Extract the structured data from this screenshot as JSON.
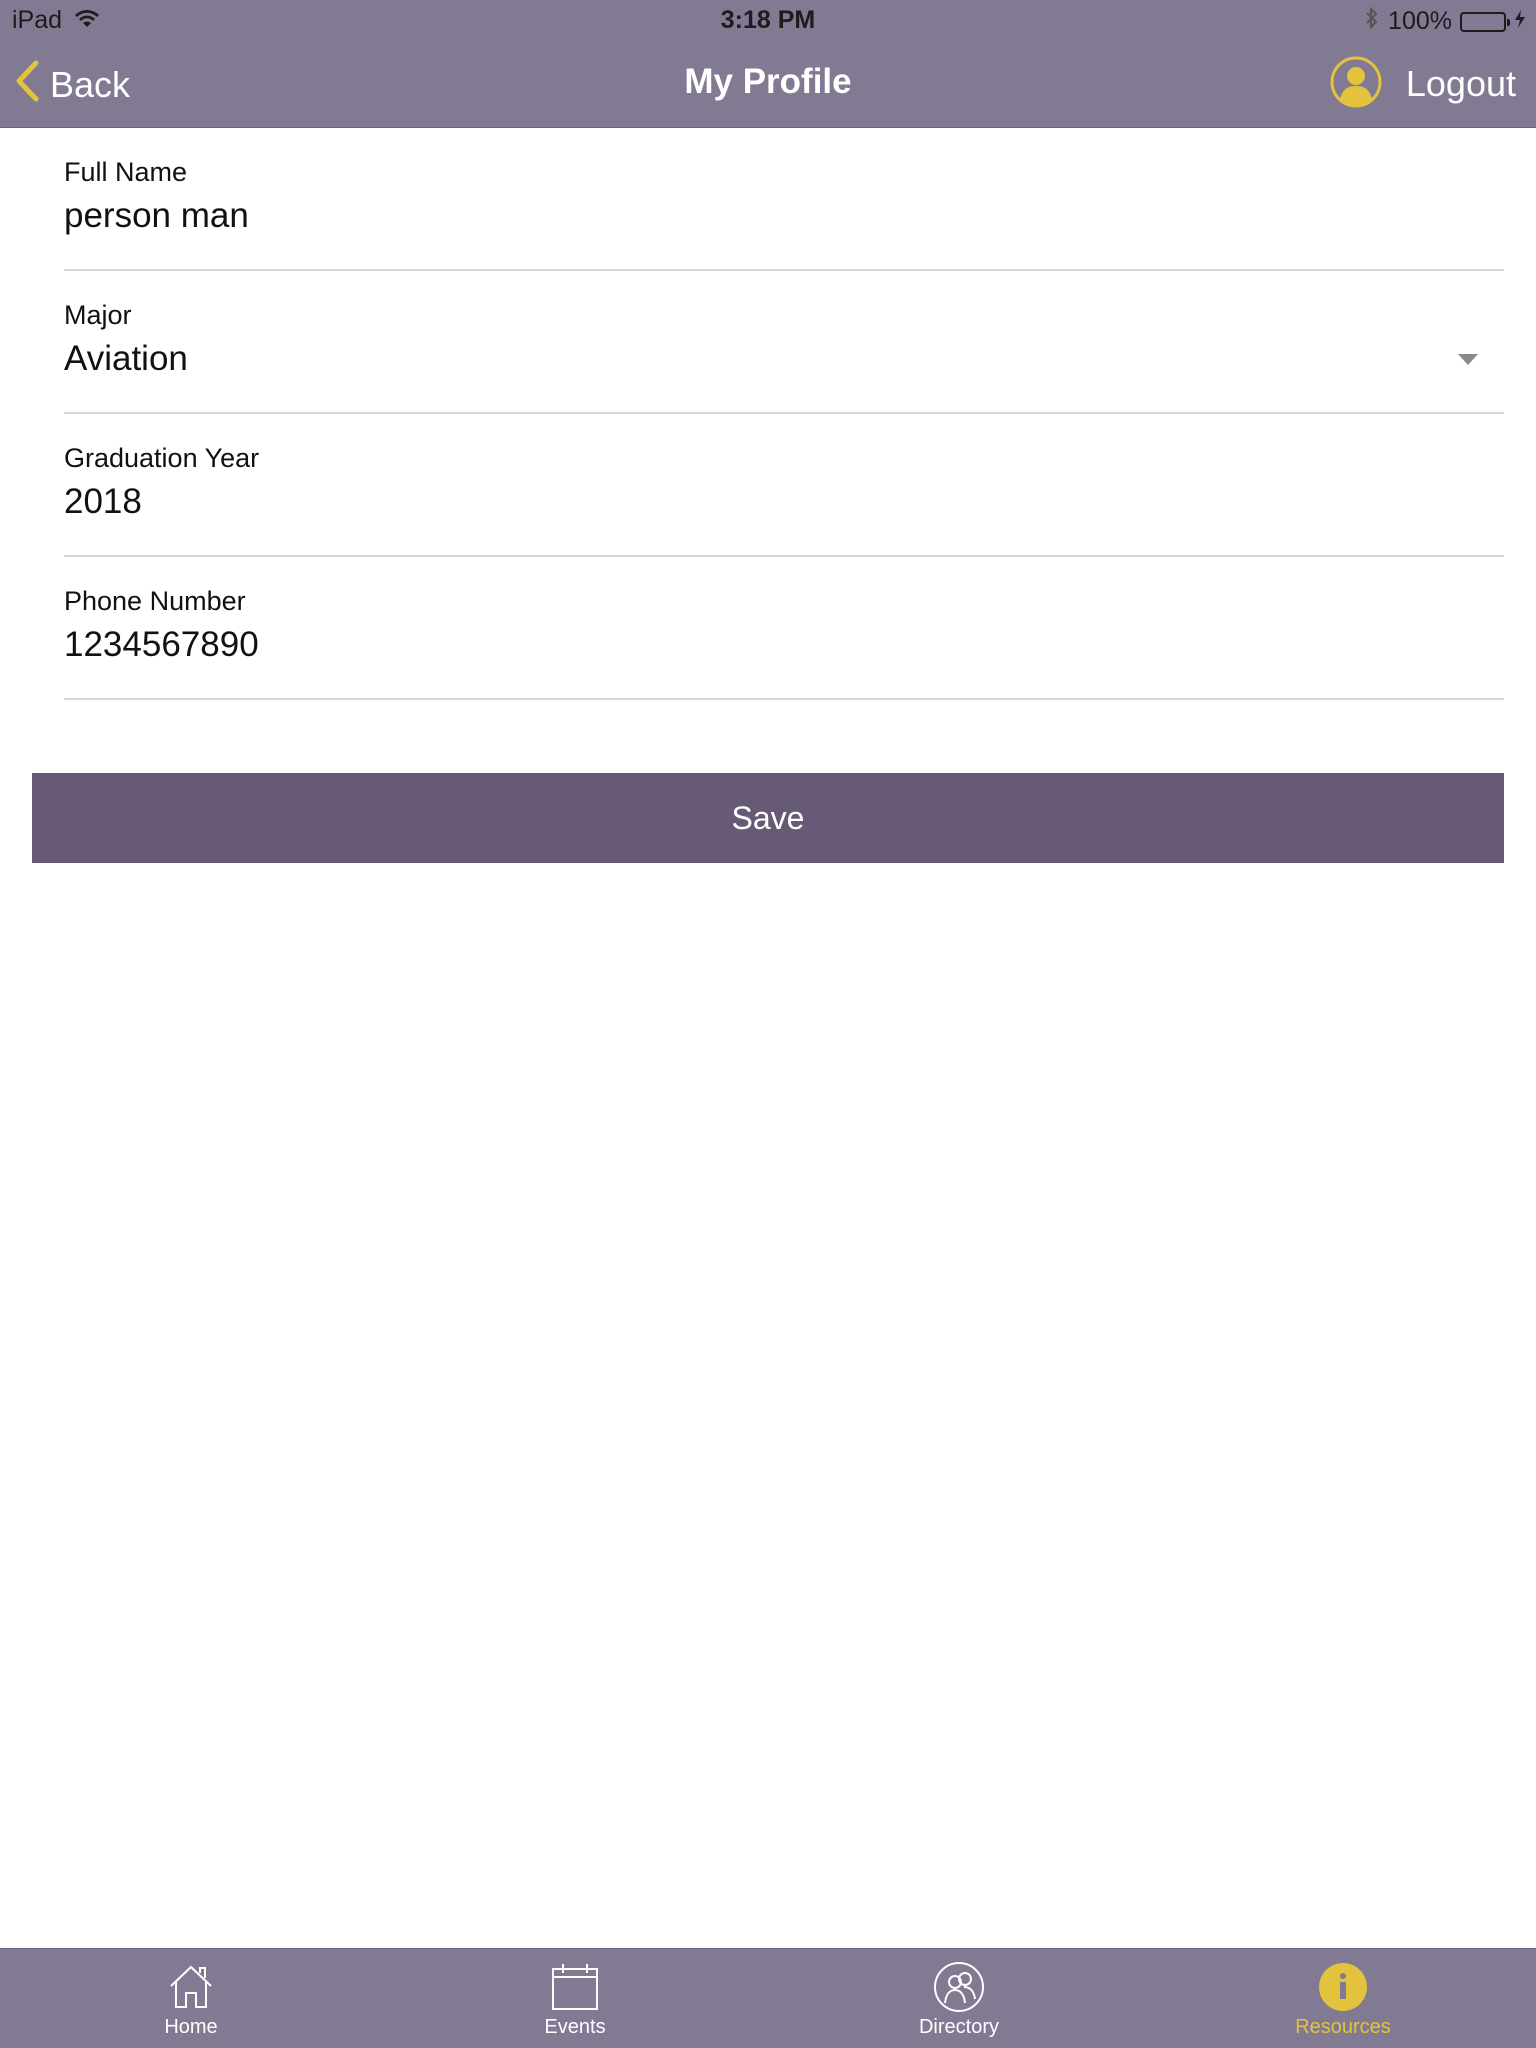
{
  "status_bar": {
    "device": "iPad",
    "time": "3:18 PM",
    "battery": "100%"
  },
  "navbar": {
    "back_label": "Back",
    "title": "My Profile",
    "logout_label": "Logout"
  },
  "form": {
    "fields": [
      {
        "label": "Full Name",
        "value": "person man"
      },
      {
        "label": "Major",
        "value": "Aviation"
      },
      {
        "label": "Graduation Year",
        "value": "2018"
      },
      {
        "label": "Phone Number",
        "value": "1234567890"
      }
    ],
    "save_label": "Save"
  },
  "tabbar": {
    "tabs": [
      {
        "label": "Home",
        "icon": "house-icon",
        "active": false
      },
      {
        "label": "Events",
        "icon": "calendar-icon",
        "active": false
      },
      {
        "label": "Directory",
        "icon": "people-icon",
        "active": false
      },
      {
        "label": "Resources",
        "icon": "info-icon",
        "active": true
      }
    ]
  },
  "colors": {
    "bar": "#827a93",
    "button": "#675a77",
    "accent": "#e3c23d"
  }
}
